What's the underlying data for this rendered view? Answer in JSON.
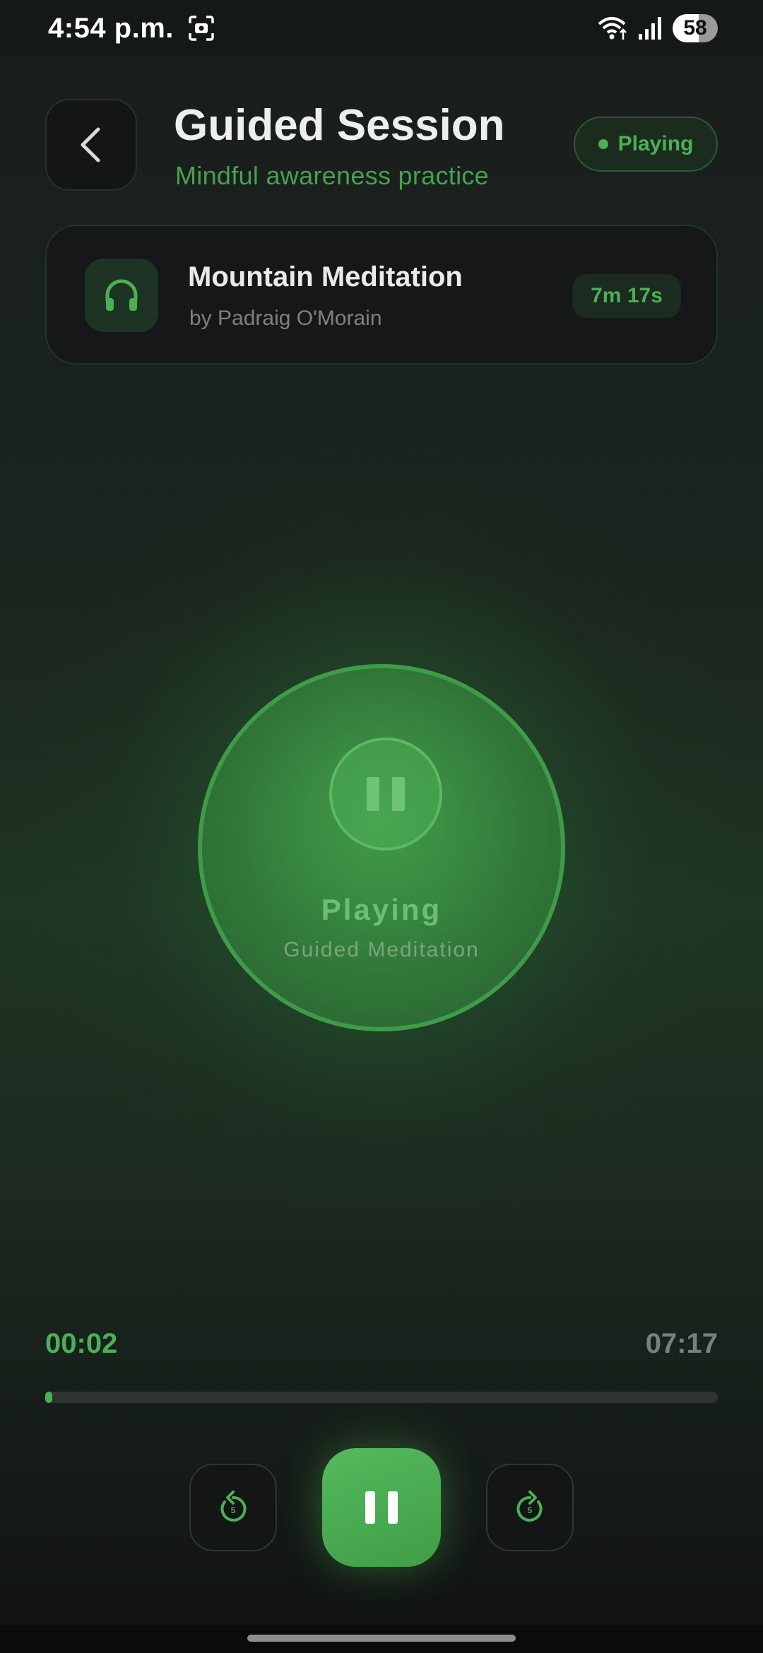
{
  "status_bar": {
    "time": "4:54 p.m.",
    "battery": "58"
  },
  "header": {
    "title": "Guided Session",
    "subtitle": "Mindful awareness practice",
    "status": "Playing"
  },
  "track": {
    "title": "Mountain Meditation",
    "author": "by Padraig O'Morain",
    "duration": "7m 17s"
  },
  "player": {
    "status": "Playing",
    "type": "Guided Meditation",
    "elapsed": "00:02",
    "total": "07:17",
    "progress_fraction": 0.005
  },
  "controls": {
    "skip_seconds": "5"
  },
  "colors": {
    "accent": "#4caf55",
    "background": "#191d1d"
  }
}
